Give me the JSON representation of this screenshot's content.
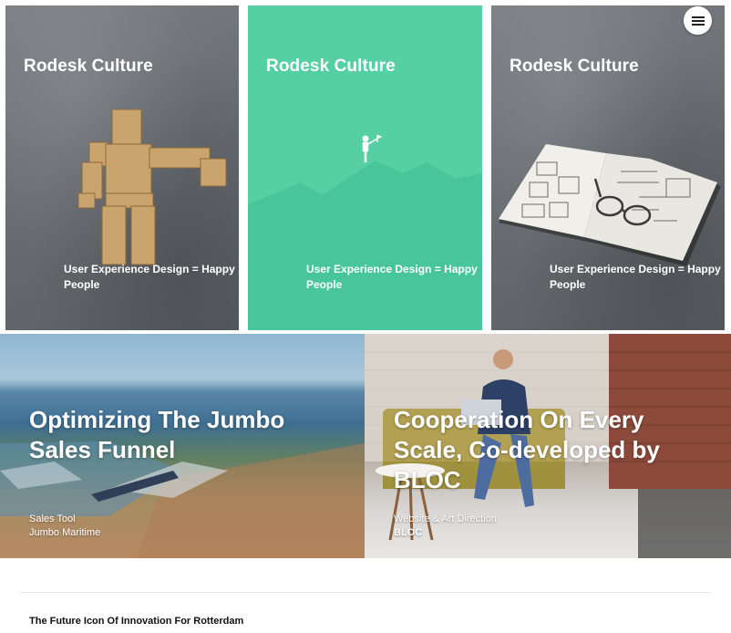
{
  "cards": [
    {
      "title": "Rodesk Culture",
      "subtitle": "User Experience Design = Happy People"
    },
    {
      "title": "Rodesk Culture",
      "subtitle": "User Experience Design = Happy People"
    },
    {
      "title": "Rodesk Culture",
      "subtitle": "User Experience Design = Happy People"
    }
  ],
  "features": [
    {
      "title": "Optimizing The Jumbo Sales Funnel",
      "category": "Sales Tool",
      "client": "Jumbo Maritime"
    },
    {
      "title": "Cooperation On Every Scale, Co-developed by BLOC",
      "category": "Website & Art Direction",
      "client": "BLOC"
    }
  ],
  "next": {
    "title": "The Future Icon Of Innovation For Rotterdam"
  },
  "icons": {
    "menu": "hamburger-menu-icon"
  },
  "colors": {
    "accent": "#55cfa3",
    "mountain": "#48c59a",
    "white": "#ffffff"
  }
}
